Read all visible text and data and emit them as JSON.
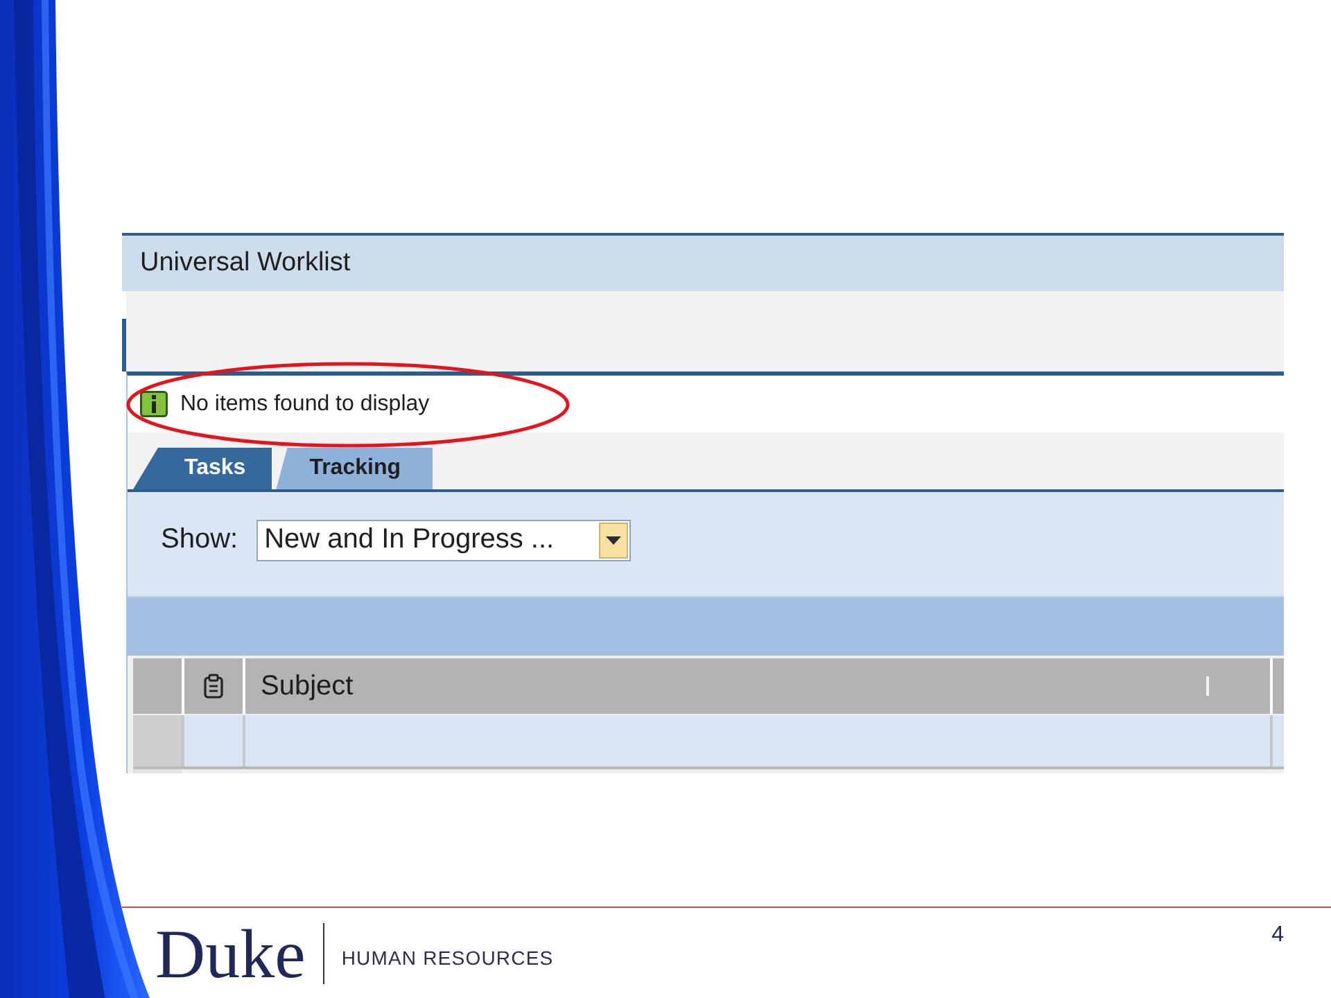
{
  "worklist": {
    "title": "Universal Worklist",
    "message": {
      "kind": "info",
      "text": "No items found to display",
      "highlighted": true
    },
    "tabs": [
      {
        "label": "Tasks",
        "selected": true
      },
      {
        "label": "Tracking",
        "selected": false
      }
    ],
    "filter": {
      "label": "Show:",
      "value": "New and In Progress ..."
    },
    "table": {
      "columns": [
        {
          "kind": "selector"
        },
        {
          "kind": "icon"
        },
        {
          "kind": "text",
          "label": "Subject"
        },
        {
          "kind": "blank"
        }
      ]
    }
  },
  "footer": {
    "logo": "Duke",
    "department": "HUMAN RESOURCES",
    "page_number": "4"
  }
}
